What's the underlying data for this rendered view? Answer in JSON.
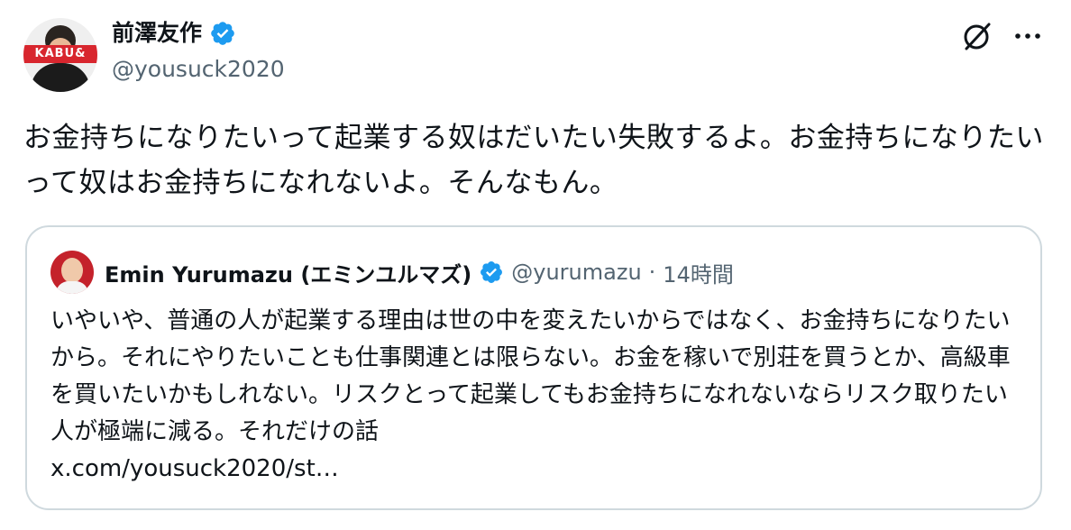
{
  "tweet": {
    "author": {
      "name": "前澤友作",
      "handle": "@yousuck2020",
      "avatar_banner_text": "KABU&"
    },
    "text": "お金持ちになりたいって起業する奴はだいたい失敗するよ。お金持ちになりたいって奴はお金持ちになれないよ。そんなもん。",
    "actions": {
      "grok_icon": "grok-icon",
      "more_icon": "more-icon",
      "more_label": "···"
    }
  },
  "quote": {
    "author": {
      "name": "Emin Yurumazu (エミンユルマズ)",
      "handle": "@yurumazu",
      "separator": "·",
      "time": "14時間"
    },
    "text": "いやいや、普通の人が起業する理由は世の中を変えたいからではなく、お金持ちになりたいから。それにやりたいことも仕事関連とは限らない。お金を稼いで別荘を買うとか、高級車を買いたいかもしれない。リスクとって起業してもお金持ちになれないならリスク取りたい人が極端に減る。それだけの話",
    "link": "x.com/yousuck2020/st…"
  },
  "colors": {
    "text": "#0f1419",
    "secondary": "#536471",
    "verified": "#1d9bf0",
    "border": "#cfd9de"
  }
}
